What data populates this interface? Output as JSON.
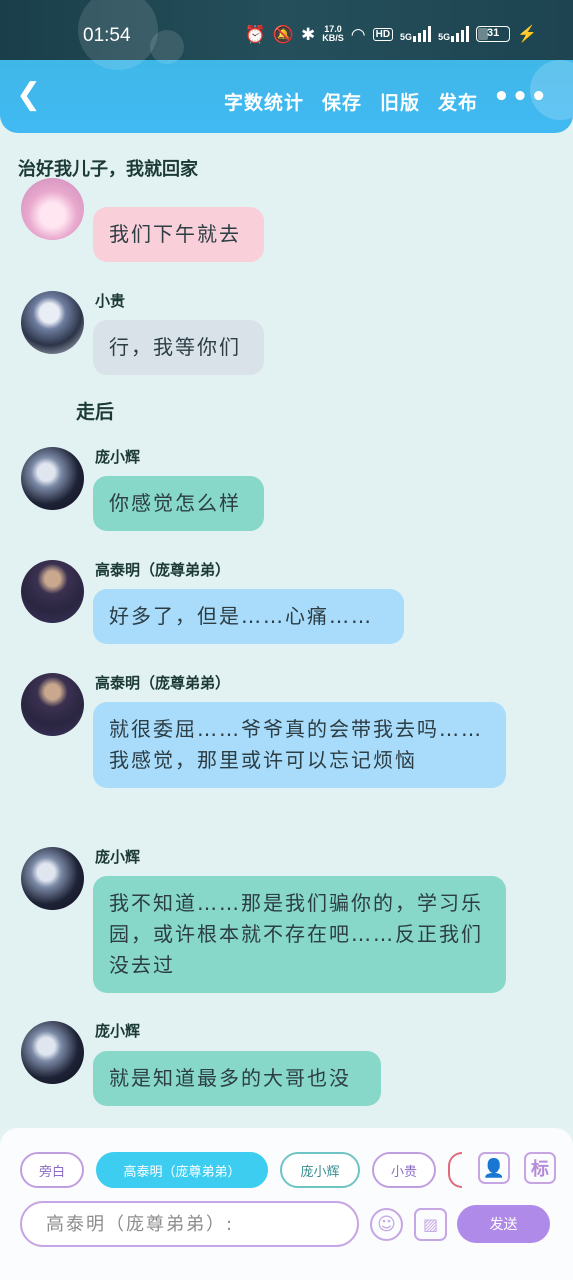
{
  "status_bar": {
    "time": "01:54",
    "speed_value": "17.0",
    "speed_unit": "KB/S",
    "hd_label": "HD",
    "signal1": "5G",
    "signal2": "5G",
    "battery": "31"
  },
  "header": {
    "menu": [
      "字数统计",
      "保存",
      "旧版",
      "发布"
    ]
  },
  "chat": {
    "chapter_title": "治好我儿子，我就回家",
    "narration": "走后",
    "messages": [
      {
        "speaker": "",
        "text": "我们下午就去"
      },
      {
        "speaker": "小贵",
        "text": "行，我等你们"
      },
      {
        "speaker": "庞小辉",
        "text": "你感觉怎么样"
      },
      {
        "speaker": "高泰明（庞尊弟弟）",
        "text": "好多了，但是……心痛……"
      },
      {
        "speaker": "高泰明（庞尊弟弟）",
        "text": "就很委屈……爷爷真的会带我去吗……我感觉，那里或许可以忘记烦恼"
      },
      {
        "speaker": "庞小辉",
        "text": "我不知道……那是我们骗你的，学习乐园，或许根本就不存在吧……反正我们没去过"
      },
      {
        "speaker": "庞小辉",
        "text": "就是知道最多的大哥也没"
      }
    ]
  },
  "panel": {
    "chips": [
      "旁白",
      "高泰明（庞尊弟弟）",
      "庞小辉",
      "小贵"
    ],
    "tag_icon_label": "标",
    "input_placeholder": "高泰明（庞尊弟弟）:",
    "send_label": "发送"
  }
}
